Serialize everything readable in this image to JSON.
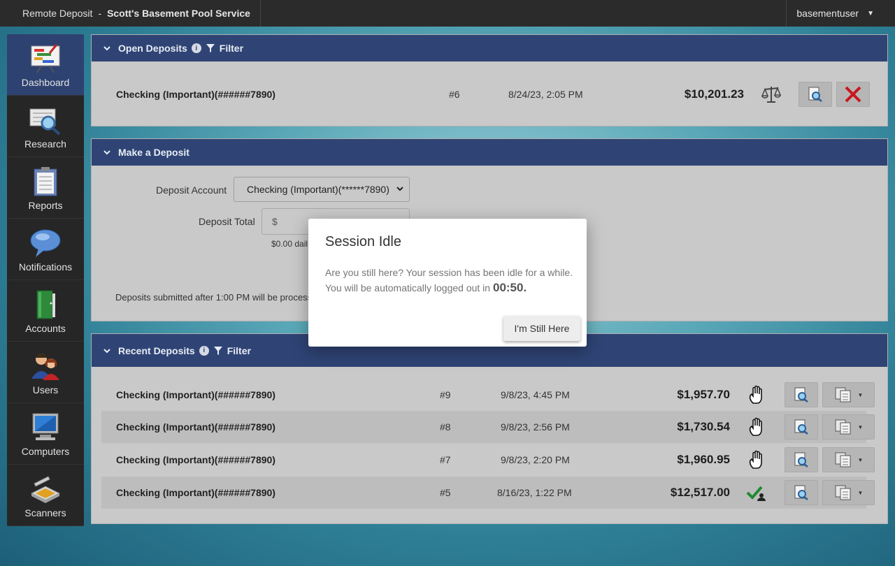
{
  "header": {
    "app_name": "Remote Deposit",
    "separator": "-",
    "org_name": "Scott's Basement Pool Service",
    "username": "basementuser"
  },
  "sidebar": {
    "items": [
      {
        "label": "Dashboard",
        "icon": "dashboard-chart-icon",
        "active": true
      },
      {
        "label": "Research",
        "icon": "magnifier-icon"
      },
      {
        "label": "Reports",
        "icon": "clipboard-icon"
      },
      {
        "label": "Notifications",
        "icon": "speech-bubble-icon"
      },
      {
        "label": "Accounts",
        "icon": "ledger-book-icon"
      },
      {
        "label": "Users",
        "icon": "users-icon"
      },
      {
        "label": "Computers",
        "icon": "monitor-icon"
      },
      {
        "label": "Scanners",
        "icon": "scanner-icon"
      }
    ]
  },
  "open_deposits": {
    "title": "Open Deposits",
    "filter_label": "Filter",
    "rows": [
      {
        "account": "Checking (Important)(######7890)",
        "number": "#6",
        "date": "8/24/23, 2:05 PM",
        "amount": "$10,201.23",
        "status_icon": "balance-scale-icon"
      }
    ]
  },
  "make_deposit": {
    "title": "Make a Deposit",
    "account_label": "Deposit Account",
    "account_value": "Checking (Important)(******7890)",
    "total_label": "Deposit Total",
    "total_prefix": "$",
    "daily_hint": "$0.00 dail",
    "cutoff_note": "Deposits submitted after 1:00 PM will be process"
  },
  "recent_deposits": {
    "title": "Recent Deposits",
    "filter_label": "Filter",
    "rows": [
      {
        "account": "Checking (Important)(######7890)",
        "number": "#9",
        "date": "9/8/23, 4:45 PM",
        "amount": "$1,957.70",
        "status_icon": "hand-icon"
      },
      {
        "account": "Checking (Important)(######7890)",
        "number": "#8",
        "date": "9/8/23, 2:56 PM",
        "amount": "$1,730.54",
        "status_icon": "hand-icon"
      },
      {
        "account": "Checking (Important)(######7890)",
        "number": "#7",
        "date": "9/8/23, 2:20 PM",
        "amount": "$1,960.95",
        "status_icon": "hand-icon"
      },
      {
        "account": "Checking (Important)(######7890)",
        "number": "#5",
        "date": "8/16/23, 1:22 PM",
        "amount": "$12,517.00",
        "status_icon": "approved-check-user-icon"
      }
    ]
  },
  "modal": {
    "title": "Session Idle",
    "message_1": "Are you still here? Your session has been idle for a while.",
    "message_2": "You will be automatically logged out in",
    "countdown": "00:50.",
    "button": "I'm Still Here"
  }
}
